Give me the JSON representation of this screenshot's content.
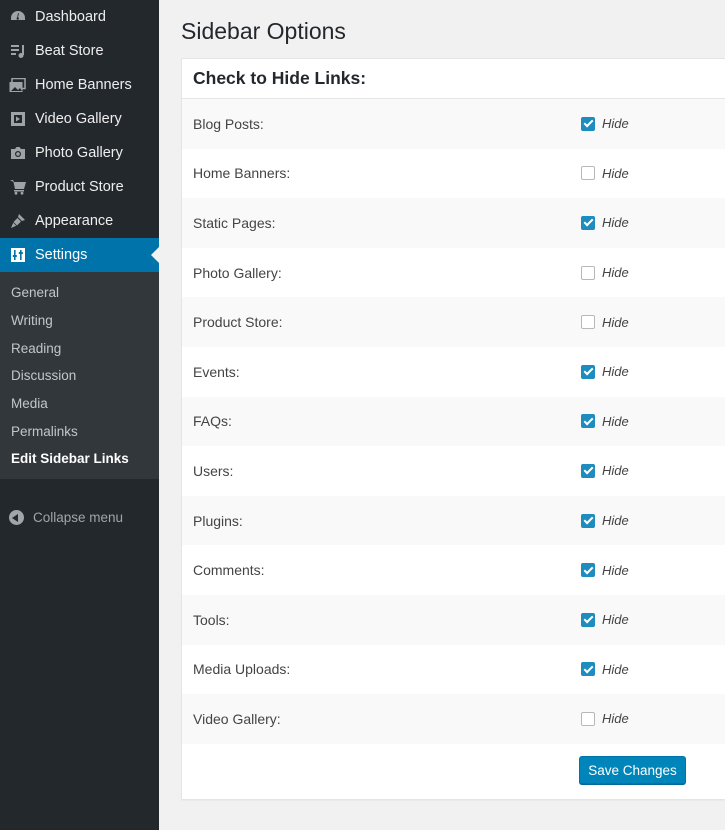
{
  "sidebar": {
    "items": [
      {
        "label": "Dashboard",
        "icon": "dashboard-icon"
      },
      {
        "label": "Beat Store",
        "icon": "music-icon"
      },
      {
        "label": "Home Banners",
        "icon": "images-icon"
      },
      {
        "label": "Video Gallery",
        "icon": "video-icon"
      },
      {
        "label": "Photo Gallery",
        "icon": "camera-icon"
      },
      {
        "label": "Product Store",
        "icon": "cart-icon"
      },
      {
        "label": "Appearance",
        "icon": "brush-icon"
      },
      {
        "label": "Settings",
        "icon": "settings-icon",
        "current": true
      }
    ],
    "submenu": [
      "General",
      "Writing",
      "Reading",
      "Discussion",
      "Media",
      "Permalinks",
      "Edit Sidebar Links"
    ],
    "submenu_current": "Edit Sidebar Links",
    "collapse_label": "Collapse menu"
  },
  "page": {
    "title": "Sidebar Options",
    "panel_heading": "Check to Hide Links:",
    "hide_label": "Hide",
    "save_label": "Save Changes",
    "rows": [
      {
        "label": "Blog Posts:",
        "checked": true
      },
      {
        "label": "Home Banners:",
        "checked": false
      },
      {
        "label": "Static Pages:",
        "checked": true
      },
      {
        "label": "Photo Gallery:",
        "checked": false
      },
      {
        "label": "Product Store:",
        "checked": false
      },
      {
        "label": "Events:",
        "checked": true
      },
      {
        "label": "FAQs:",
        "checked": true
      },
      {
        "label": "Users:",
        "checked": true
      },
      {
        "label": "Plugins:",
        "checked": true
      },
      {
        "label": "Comments:",
        "checked": true
      },
      {
        "label": "Tools:",
        "checked": true
      },
      {
        "label": "Media Uploads:",
        "checked": true
      },
      {
        "label": "Video Gallery:",
        "checked": false
      }
    ]
  },
  "colors": {
    "sidebar_bg": "#23282d",
    "submenu_bg": "#32373c",
    "accent": "#0073aa",
    "checkbox_checked": "#1e8cbe",
    "button": "#0085ba"
  }
}
